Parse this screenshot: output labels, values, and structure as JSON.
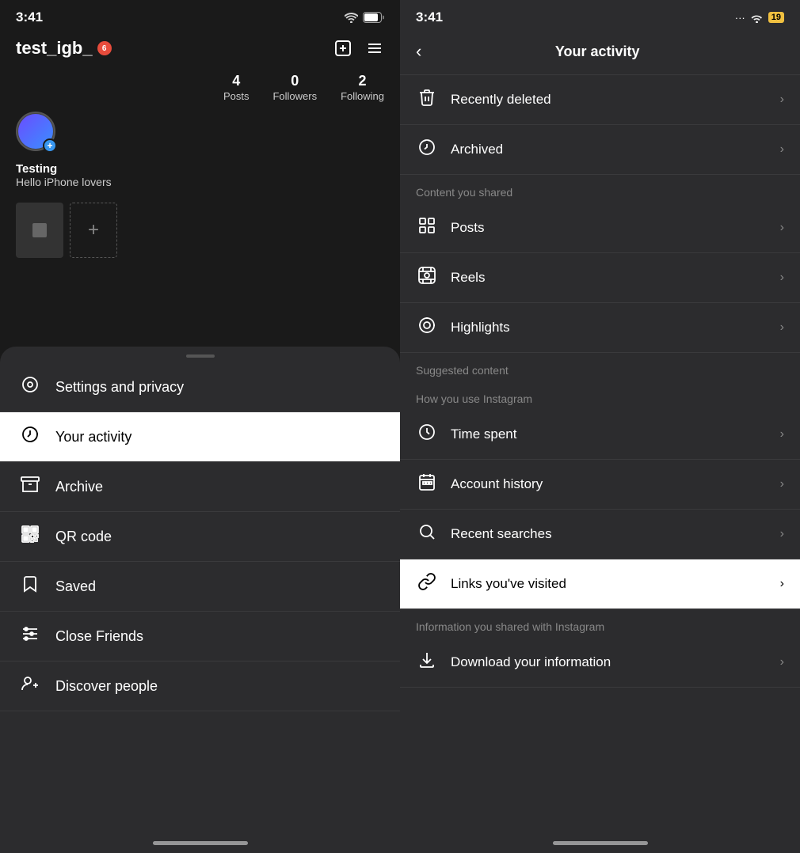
{
  "left": {
    "statusBar": {
      "time": "3:41",
      "wifiIcon": "wifi",
      "batteryIcon": "battery"
    },
    "header": {
      "username": "test_igb_",
      "notifCount": "6"
    },
    "profile": {
      "stats": [
        {
          "number": "4",
          "label": "Posts"
        },
        {
          "number": "0",
          "label": "Followers"
        },
        {
          "number": "2",
          "label": "Following"
        }
      ],
      "name": "Testing",
      "bio": "Hello iPhone lovers"
    },
    "sheetHandle": "",
    "menuItems": [
      {
        "id": "settings",
        "icon": "settings",
        "label": "Settings and privacy"
      },
      {
        "id": "your-activity",
        "icon": "activity",
        "label": "Your activity",
        "active": true
      },
      {
        "id": "archive",
        "icon": "archive",
        "label": "Archive"
      },
      {
        "id": "qr-code",
        "icon": "qr",
        "label": "QR code"
      },
      {
        "id": "saved",
        "icon": "saved",
        "label": "Saved"
      },
      {
        "id": "close-friends",
        "icon": "close-friends",
        "label": "Close Friends"
      },
      {
        "id": "discover",
        "icon": "discover",
        "label": "Discover people"
      }
    ]
  },
  "right": {
    "statusBar": {
      "time": "3:41",
      "signalText": "...",
      "wifiIcon": "wifi",
      "batteryText": "19"
    },
    "header": {
      "backLabel": "‹",
      "title": "Your activity"
    },
    "topItems": [
      {
        "id": "recently-deleted",
        "icon": "trash",
        "label": "Recently deleted"
      },
      {
        "id": "archived",
        "icon": "archive",
        "label": "Archived"
      }
    ],
    "sections": [
      {
        "sectionLabel": "Content you shared",
        "items": [
          {
            "id": "posts",
            "icon": "grid",
            "label": "Posts"
          },
          {
            "id": "reels",
            "icon": "reels",
            "label": "Reels"
          },
          {
            "id": "highlights",
            "icon": "highlights",
            "label": "Highlights"
          }
        ]
      },
      {
        "sectionLabel": "Suggested content",
        "items": []
      },
      {
        "sectionLabel": "How you use Instagram",
        "items": [
          {
            "id": "time-spent",
            "icon": "clock",
            "label": "Time spent"
          },
          {
            "id": "account-history",
            "icon": "calendar",
            "label": "Account history"
          },
          {
            "id": "recent-searches",
            "icon": "search",
            "label": "Recent searches"
          },
          {
            "id": "links-visited",
            "icon": "link",
            "label": "Links you've visited",
            "active": true
          }
        ]
      },
      {
        "sectionLabel": "Information you shared with Instagram",
        "items": [
          {
            "id": "download-info",
            "icon": "download",
            "label": "Download your information"
          }
        ]
      }
    ]
  }
}
